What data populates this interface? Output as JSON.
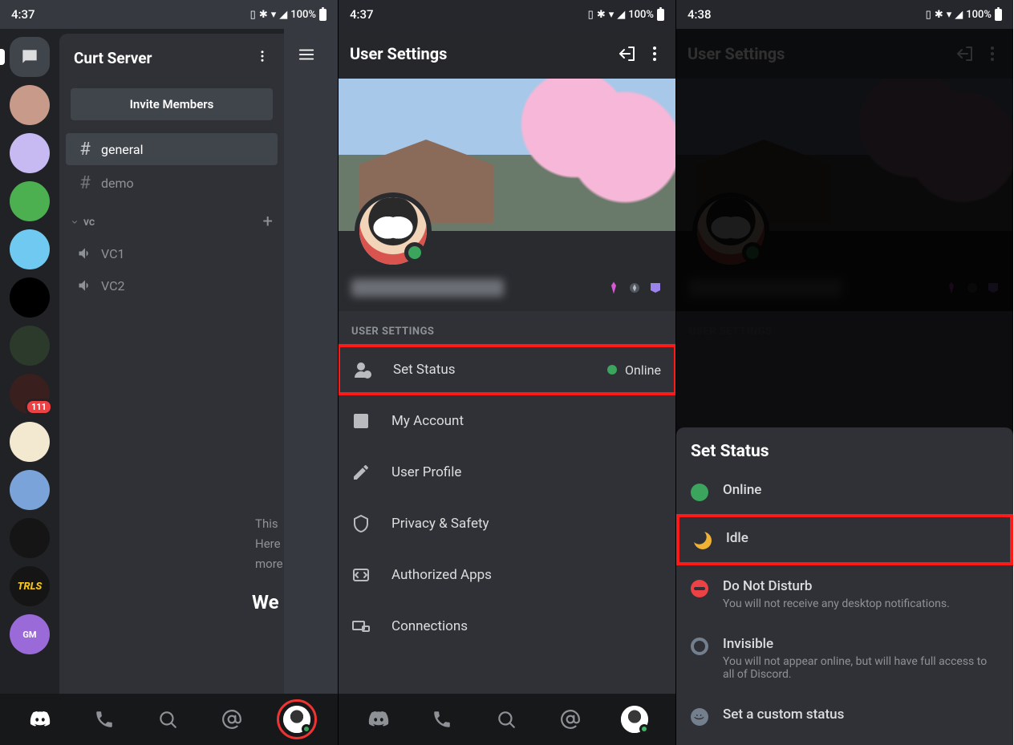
{
  "p1": {
    "status": {
      "time": "4:37",
      "battery": "100%"
    },
    "server_name": "Curt Server",
    "invite_label": "Invite Members",
    "text_channels": [
      {
        "name": "general",
        "active": true
      },
      {
        "name": "demo",
        "active": false
      }
    ],
    "vc_category": "vc",
    "voice_channels": [
      {
        "name": "VC1"
      },
      {
        "name": "VC2"
      }
    ],
    "server_icons": [
      {
        "variant": "dm",
        "pill": true
      },
      {
        "variant": "pig",
        "color": "#c79a8a"
      },
      {
        "variant": "anime1",
        "color": "#c7b9f2"
      },
      {
        "variant": "green",
        "color": "#4caf50"
      },
      {
        "variant": "anime2",
        "color": "#6fc9f0"
      },
      {
        "variant": "logo-bw",
        "color": "#000000"
      },
      {
        "variant": "helmet",
        "color": "#2b3a2b"
      },
      {
        "variant": "dark",
        "color": "#3a1f1f",
        "badge": "111"
      },
      {
        "variant": "fgo",
        "color": "#f2e9d0"
      },
      {
        "variant": "fgo2",
        "color": "#7aa3d9"
      },
      {
        "variant": "pixel",
        "color": "#151515"
      },
      {
        "variant": "trls",
        "color": "#151515",
        "label": "TRLS",
        "labelColor": "#f5c518"
      },
      {
        "variant": "gm",
        "color": "#9a6bd8",
        "label": "GM"
      }
    ],
    "peek": {
      "welcome": "We",
      "line1": "This",
      "line2": "Here",
      "line3": "more"
    }
  },
  "p2": {
    "status": {
      "time": "4:37",
      "battery": "100%"
    },
    "title": "User Settings",
    "section": "USER SETTINGS",
    "items": [
      {
        "key": "set-status",
        "label": "Set Status",
        "trailing": "Online",
        "dot": true,
        "highlight": true
      },
      {
        "key": "my-account",
        "label": "My Account"
      },
      {
        "key": "user-profile",
        "label": "User Profile"
      },
      {
        "key": "privacy-safety",
        "label": "Privacy & Safety"
      },
      {
        "key": "authorized-apps",
        "label": "Authorized Apps"
      },
      {
        "key": "connections",
        "label": "Connections"
      }
    ]
  },
  "p3": {
    "status": {
      "time": "4:38",
      "battery": "100%"
    },
    "title": "User Settings",
    "section": "USER SETTINGS",
    "sheet_title": "Set Status",
    "statuses": [
      {
        "key": "online",
        "name": "Online",
        "desc": ""
      },
      {
        "key": "idle",
        "name": "Idle",
        "desc": "",
        "highlight": true
      },
      {
        "key": "dnd",
        "name": "Do Not Disturb",
        "desc": "You will not receive any desktop notifications."
      },
      {
        "key": "invisible",
        "name": "Invisible",
        "desc": "You will not appear online, but will have full access to all of Discord."
      },
      {
        "key": "custom",
        "name": "Set a custom status",
        "desc": ""
      }
    ]
  }
}
